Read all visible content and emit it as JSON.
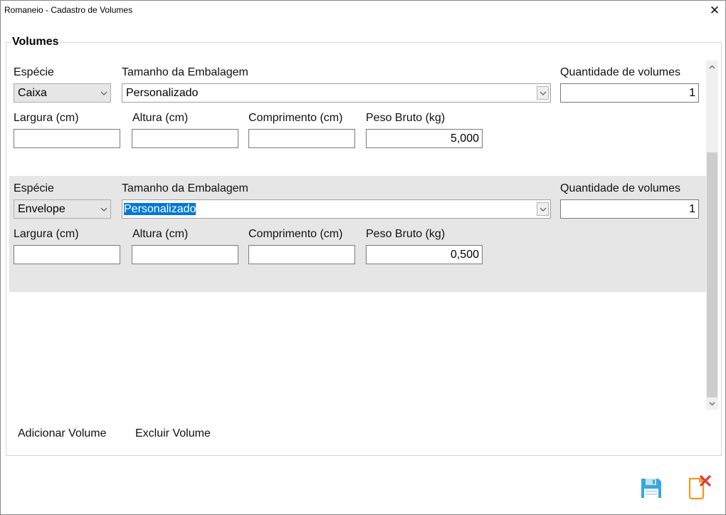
{
  "window": {
    "title": "Romaneio - Cadastro de Volumes",
    "close_glyph": "✕"
  },
  "group": {
    "title": "Volumes"
  },
  "labels": {
    "especie": "Espécie",
    "tamanho": "Tamanho da Embalagem",
    "quantidade": "Quantidade de volumes",
    "largura": "Largura (cm)",
    "altura": "Altura (cm)",
    "comprimento": "Comprimento (cm)",
    "peso": "Peso Bruto (kg)"
  },
  "volumes": [
    {
      "especie": "Caixa",
      "tamanho": "Personalizado",
      "quantidade": "1",
      "largura": "",
      "altura": "",
      "comprimento": "",
      "peso": "5,000"
    },
    {
      "especie": "Envelope",
      "tamanho": "Personalizado",
      "quantidade": "1",
      "largura": "",
      "altura": "",
      "comprimento": "",
      "peso": "0,500"
    }
  ],
  "actions": {
    "add": "Adicionar Volume",
    "delete": "Excluir Volume"
  },
  "icons": {
    "save": "save-disk-icon",
    "cancel": "cancel-document-icon",
    "combo_arrow": "chevron-down-icon",
    "scroll_up": "scroll-up-arrow-icon",
    "scroll_down": "scroll-down-arrow-icon"
  },
  "colors": {
    "selection": "#0078d7",
    "alt_row": "#e6e6e6",
    "save_icon": "#3aa6e0",
    "cancel_icon": "#f29b1d",
    "cancel_x": "#e53935"
  }
}
